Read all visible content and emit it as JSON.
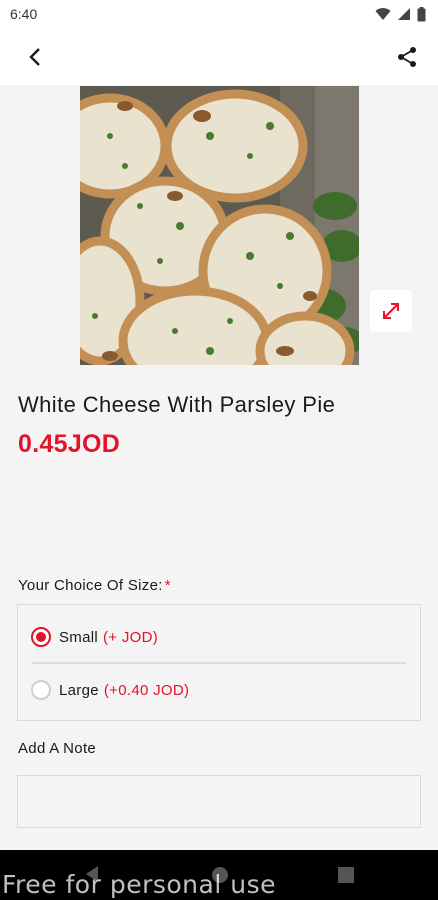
{
  "status_bar": {
    "time": "6:40"
  },
  "product": {
    "title": "White Cheese With Parsley Pie",
    "price": "0.45JOD",
    "image_alt": "pie-photo"
  },
  "size_section": {
    "label": "Your Choice Of Size:",
    "required_marker": "*",
    "options": [
      {
        "name": "Small",
        "extra": "(+ JOD)",
        "selected": true
      },
      {
        "name": "Large",
        "extra": "(+0.40 JOD)",
        "selected": false
      }
    ]
  },
  "note_section": {
    "label": "Add A Note",
    "value": "",
    "placeholder": ""
  },
  "watermark": "Free for personal use",
  "colors": {
    "accent": "#e3132b",
    "background": "#f4f4f4"
  }
}
